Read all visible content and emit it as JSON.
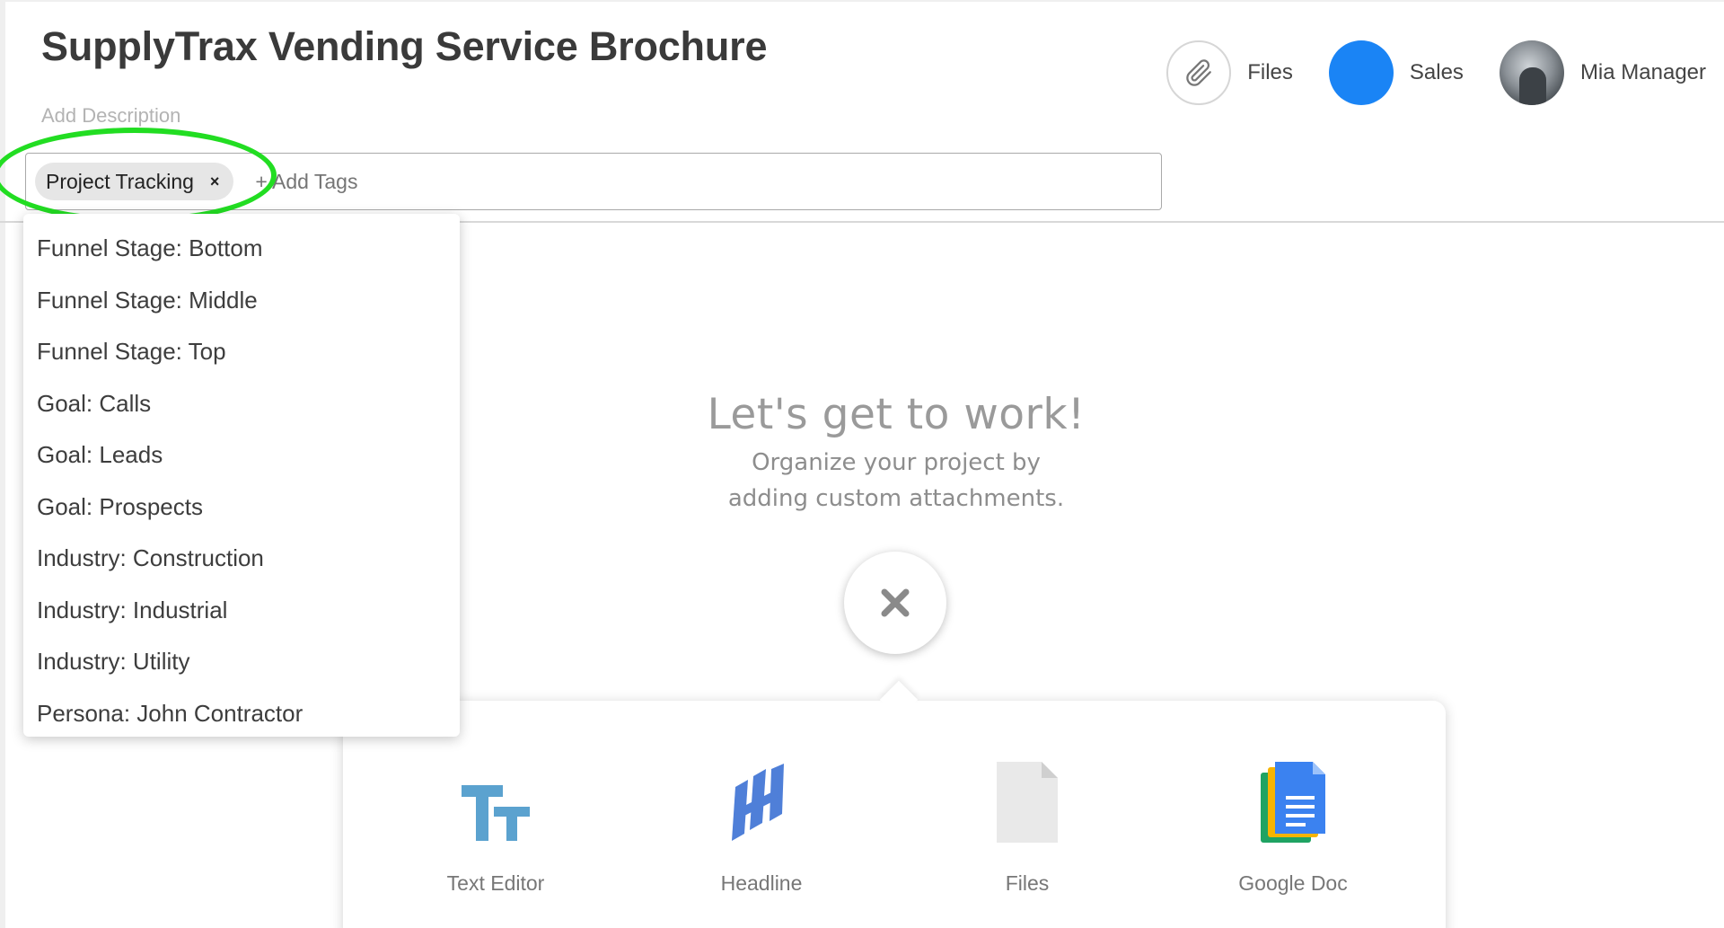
{
  "header": {
    "title": "SupplyTrax Vending Service Brochure",
    "description_placeholder": "Add Description",
    "files_label": "Files",
    "sales_label": "Sales",
    "user_name": "Mia Manager"
  },
  "tags": {
    "chip_label": "Project Tracking",
    "chip_remove": "×",
    "add_placeholder": "+ Add Tags"
  },
  "dropdown": {
    "items": [
      "Funnel Stage: Bottom",
      "Funnel Stage: Middle",
      "Funnel Stage: Top",
      "Goal: Calls",
      "Goal: Leads",
      "Goal: Prospects",
      "Industry: Construction",
      "Industry: Industrial",
      "Industry: Utility",
      "Persona: John Contractor"
    ]
  },
  "empty_state": {
    "title": "Let's get to work!",
    "line1": "Organize your project by",
    "line2": "adding custom attachments."
  },
  "attachments": {
    "text_editor": "Text Editor",
    "headline": "Headline",
    "files": "Files",
    "google_doc": "Google Doc"
  },
  "colors": {
    "sales": "#1a84f5",
    "highlight": "#22dd22"
  },
  "icons": {
    "files": "paperclip-icon",
    "close": "close-icon",
    "text_editor": "text-editor-icon",
    "headline": "headline-icon",
    "file": "file-icon",
    "google_doc": "google-doc-icon"
  }
}
